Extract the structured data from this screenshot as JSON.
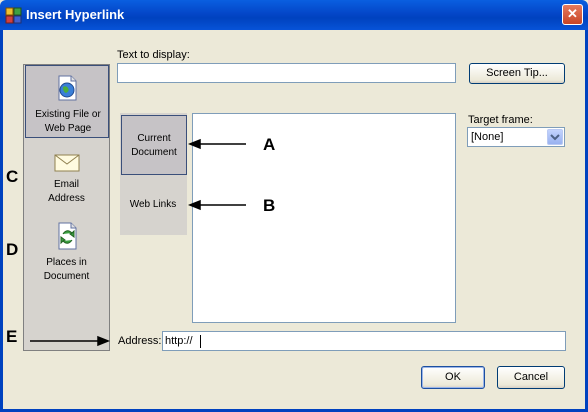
{
  "window": {
    "title": "Insert Hyperlink",
    "close_glyph": "✕"
  },
  "sidebar": {
    "items": [
      {
        "label_line1": "Existing File or",
        "label_line2": "Web Page",
        "icon": "globe-document-icon"
      },
      {
        "label_line1": "Email",
        "label_line2": "Address",
        "icon": "envelope-icon"
      },
      {
        "label_line1": "Places in",
        "label_line2": "Document",
        "icon": "document-arrows-icon"
      }
    ]
  },
  "form": {
    "text_to_display_label": "Text to display:",
    "text_to_display_value": "",
    "screen_tip_label": "Screen Tip...",
    "target_frame_label": "Target frame:",
    "target_frame_value": "[None]",
    "address_label": "Address:",
    "address_value": "http://"
  },
  "tabs": [
    {
      "line1": "Current",
      "line2": "Document"
    },
    {
      "line1": "Web Links",
      "line2": ""
    }
  ],
  "buttons": {
    "ok": "OK",
    "cancel": "Cancel"
  },
  "annotations": {
    "a": "A",
    "b": "B",
    "c": "C",
    "d": "D",
    "e": "E"
  }
}
